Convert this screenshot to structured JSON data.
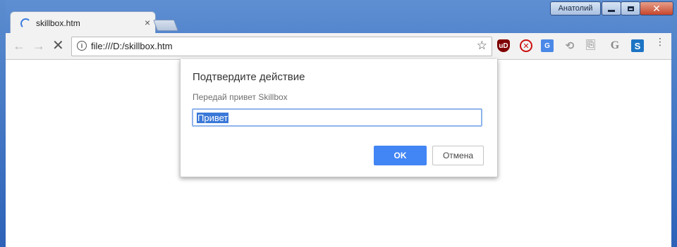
{
  "window": {
    "profile_name": "Анатолий",
    "close_glyph": "✕"
  },
  "tab": {
    "title": "skillbox.htm",
    "close_glyph": "×"
  },
  "toolbar": {
    "back_glyph": "←",
    "forward_glyph": "→",
    "stop_glyph": "✕",
    "url": "file:///D:/skillbox.htm",
    "info_glyph": "i",
    "star_glyph": "☆",
    "menu_glyph": "⋮",
    "extensions": [
      {
        "name": "ublock-icon",
        "label": "uD"
      },
      {
        "name": "block-icon",
        "label": "✕"
      },
      {
        "name": "translate-icon",
        "label": "G"
      },
      {
        "name": "history-icon",
        "label": "⟲"
      },
      {
        "name": "copy-icon",
        "label": "⎘"
      },
      {
        "name": "grammarly-icon",
        "label": "G"
      },
      {
        "name": "s-extension-icon",
        "label": "S"
      }
    ]
  },
  "dialog": {
    "title": "Подтвердите действие",
    "message": "Передай привет Skillbox",
    "input_value": "Привет",
    "ok_label": "OK",
    "cancel_label": "Отмена"
  },
  "colors": {
    "accent": "#4285f4",
    "selection": "#3a78d8",
    "frame": "#4f82cc"
  }
}
